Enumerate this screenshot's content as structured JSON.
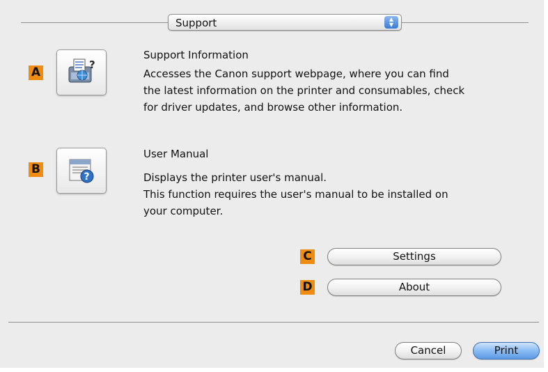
{
  "header": {
    "popup_value": "Support"
  },
  "sections": {
    "a": {
      "badge": "A",
      "icon": "support-info-icon",
      "title": "Support Information",
      "desc_lines": [
        "Accesses the Canon support webpage, where you can find",
        "the latest information on the printer and consumables, check",
        "for driver updates, and browse other information."
      ]
    },
    "b": {
      "badge": "B",
      "icon": "user-manual-icon",
      "title": "User Manual",
      "desc_lines": [
        "Displays the printer user's manual.",
        "This function requires the user's manual to be installed on",
        "your computer."
      ]
    }
  },
  "buttons": {
    "settings": {
      "badge": "C",
      "label": "Settings"
    },
    "about": {
      "badge": "D",
      "label": "About"
    },
    "cancel": {
      "label": "Cancel"
    },
    "print": {
      "label": "Print"
    }
  },
  "colors": {
    "badge": "#f08c12",
    "primary_button": "#5d9be6",
    "background": "#ececec"
  }
}
